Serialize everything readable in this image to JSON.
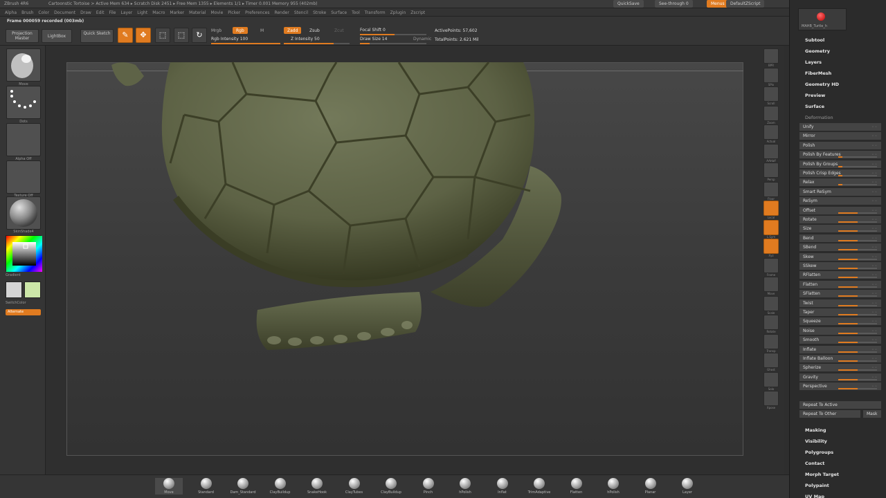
{
  "titlebar": {
    "app": "ZBrush 4R6",
    "status": "Cartoonstic Tortoise >  Active Mem 634 ▸ Scratch Disk 2451 ▸ Free Mem 1355 ▸ Elements 1/1 ▸ Timer 0.001 Memory 955 (402mb)",
    "quicksave": "QuickSave",
    "seethrough": "See-through 0",
    "menus_btn": "Menus",
    "script": "DefaultZScript"
  },
  "menubar": [
    "Alpha",
    "Brush",
    "Color",
    "Document",
    "Draw",
    "Edit",
    "File",
    "Layer",
    "Light",
    "Macro",
    "Marker",
    "Material",
    "Movie",
    "Picker",
    "Preferences",
    "Render",
    "Stencil",
    "Stroke",
    "Surface",
    "Tool",
    "Transform",
    "Zplugin",
    "Zscript"
  ],
  "toolbar": {
    "frame_label": "Frame 000059 recorded (003mb)",
    "projection_master": "Projection Master",
    "lightbox": "LightBox",
    "quick_sketch": "Quick Sketch",
    "edit": "Edit",
    "draw": "Draw",
    "move": "Move",
    "scale": "Scale",
    "rotate": "Rotate",
    "mrgb": "Mrgb",
    "rgb": "Rgb",
    "m": "M",
    "rgb_intensity": "Rgb Intensity 100",
    "zadd": "Zadd",
    "zsub": "Zsub",
    "zcut": "Zcut",
    "z_intensity": "Z Intensity 50",
    "focal_shift": "Focal Shift 0",
    "draw_size": "Draw Size 14",
    "dynamic": "Dynamic",
    "active_points": "ActivePoints: 57,602",
    "total_points": "TotalPoints: 2.621 Mil"
  },
  "leftshelf": {
    "brush_label": "Move",
    "stroke_label": "Dots",
    "alpha_label": "Alpha Off",
    "texture_label": "Texture Off",
    "material_label": "SkinShade4",
    "gradient": "Gradient",
    "switch_color": "SwitchColor",
    "alternate": "Alternate"
  },
  "rightcol": [
    "BPR",
    "SPix",
    "Scroll",
    "Zoom",
    "Actual",
    "AAHalf",
    "Persp",
    "Floor",
    "Local",
    "L.Sym",
    "Xyz",
    "Frame",
    "Move",
    "Scale",
    "Rotate",
    "Transp",
    "Ghost",
    "Solo",
    "Xpose"
  ],
  "rightpanel": {
    "material_name": "MAHB_Turtle_h",
    "sections_top": [
      "Subtool",
      "Geometry",
      "Layers",
      "FiberMesh",
      "Geometry HD",
      "Preview",
      "Surface",
      "Deformation"
    ],
    "deformation": [
      {
        "label": "Unify",
        "fill": 0
      },
      {
        "label": "Mirror",
        "fill": 0
      },
      {
        "label": "Polish",
        "fill": 0
      },
      {
        "label": "Polish By Features",
        "fill": 0.1
      },
      {
        "label": "Polish By Groups",
        "fill": 0.1
      },
      {
        "label": "Polish Crisp Edges",
        "fill": 0.1
      },
      {
        "label": "Relax",
        "fill": 0.1
      },
      {
        "label": "Smart ReSym",
        "fill": 0
      },
      {
        "label": "ReSym",
        "fill": 0
      },
      {
        "label": "Offset",
        "fill": 0.5
      },
      {
        "label": "Rotate",
        "fill": 0.5
      },
      {
        "label": "Size",
        "fill": 0.5
      },
      {
        "label": "Bend",
        "fill": 0.5
      },
      {
        "label": "SBend",
        "fill": 0.5
      },
      {
        "label": "Skew",
        "fill": 0.5
      },
      {
        "label": "SSkew",
        "fill": 0.5
      },
      {
        "label": "RFlatten",
        "fill": 0.5
      },
      {
        "label": "Flatten",
        "fill": 0.5
      },
      {
        "label": "SFlatten",
        "fill": 0.5
      },
      {
        "label": "Twist",
        "fill": 0.5
      },
      {
        "label": "Taper",
        "fill": 0.5
      },
      {
        "label": "Squeeze",
        "fill": 0.5
      },
      {
        "label": "Noise",
        "fill": 0.5
      },
      {
        "label": "Smooth",
        "fill": 0.5
      },
      {
        "label": "Inflate",
        "fill": 0.5
      },
      {
        "label": "Inflate Balloon",
        "fill": 0.5
      },
      {
        "label": "Spherize",
        "fill": 0.5
      },
      {
        "label": "Gravity",
        "fill": 0.5
      },
      {
        "label": "Perspective",
        "fill": 0.5
      }
    ],
    "repeat_active": "Repeat To Active",
    "repeat_other": "Repeat To Other",
    "mask": "Mask",
    "sections_bottom": [
      "Masking",
      "Visibility",
      "Polygroups",
      "Contact",
      "Morph Target",
      "Polypaint",
      "UV Map"
    ]
  },
  "brushes": [
    "Move",
    "Standard",
    "Dam_Standard",
    "ClayBuildup",
    "SnakeHook",
    "ClayTubes",
    "ClayBuildup",
    "Pinch",
    "hPolish",
    "Inflat",
    "TrimAdaptive",
    "Flatten",
    "hPolish",
    "Planar",
    "Layer"
  ],
  "colors": {
    "accent": "#e07b20",
    "turtle": "#5f6447"
  }
}
